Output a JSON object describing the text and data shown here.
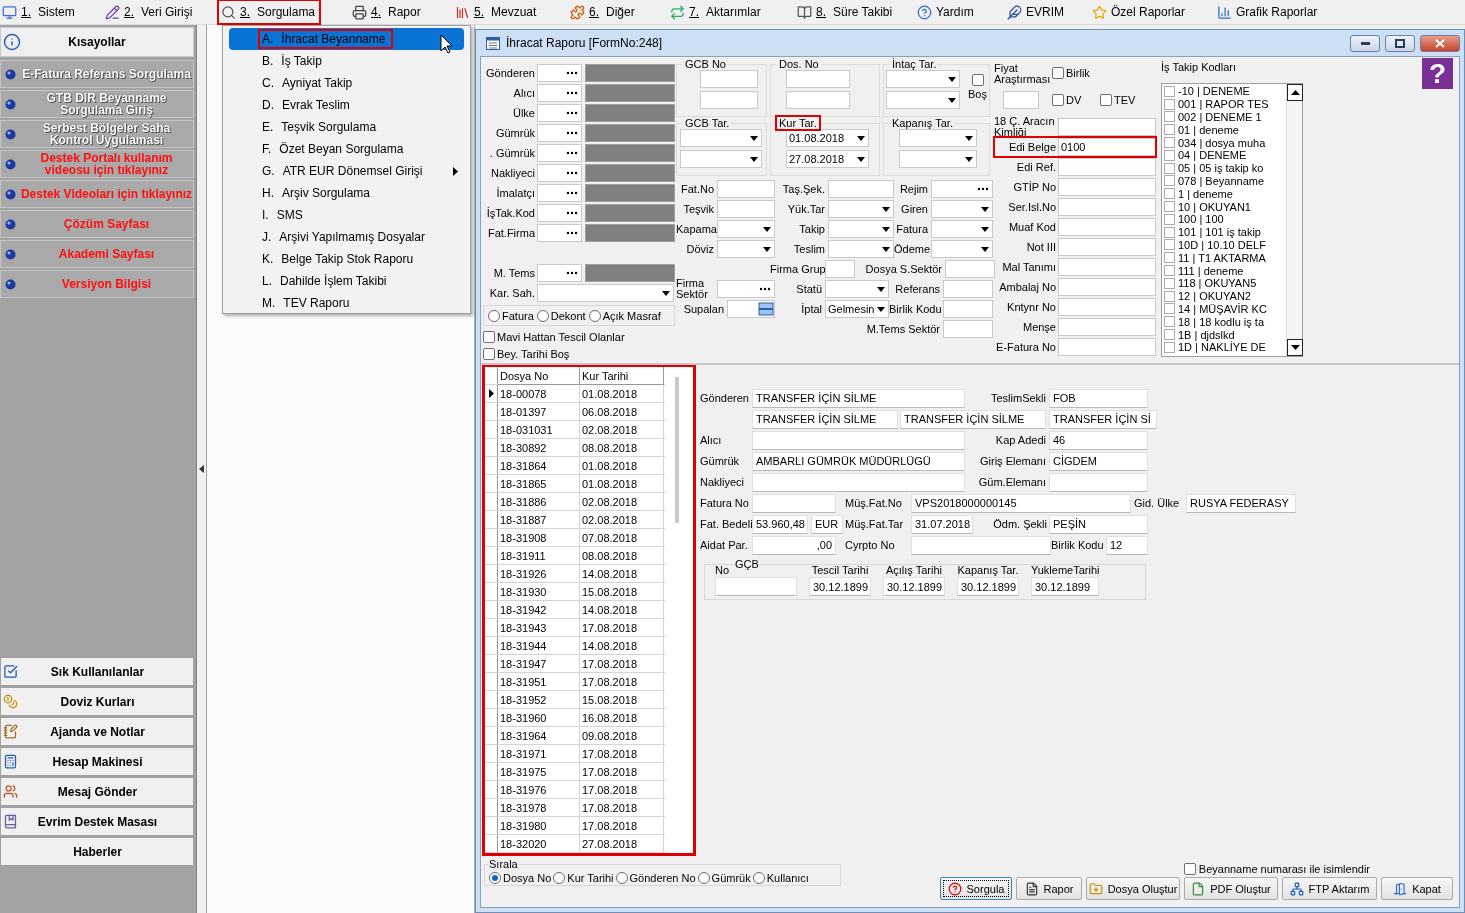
{
  "menu_bar": [
    {
      "key": "1.",
      "label": "Sistem",
      "marked": false
    },
    {
      "key": "2.",
      "label": "Veri Girişi",
      "marked": false
    },
    {
      "key": "3.",
      "label": "Sorgulama",
      "marked": true
    },
    {
      "key": "4.",
      "label": "Rapor",
      "marked": false
    },
    {
      "key": "5.",
      "label": "Mevzuat",
      "marked": false
    },
    {
      "key": "6.",
      "label": "Diğer",
      "marked": false
    },
    {
      "key": "7.",
      "label": "Aktarımlar",
      "marked": false
    },
    {
      "key": "8.",
      "label": "Süre Takibi",
      "marked": false
    },
    {
      "label": "Yardım",
      "marked": false
    },
    {
      "label": "EVRIM",
      "marked": false
    },
    {
      "label": "Özel Raporlar",
      "marked": false
    },
    {
      "label": "Grafik Raporlar",
      "marked": false
    }
  ],
  "sidebar": {
    "title": "Kısayollar",
    "links": [
      {
        "label": "E-Fatura Referans Sorgulama",
        "kind": "plain"
      },
      {
        "label": "GTB DIR Beyanname Sorgulama Giriş",
        "kind": "plain"
      },
      {
        "label": "Serbest Bölgeler Saha Kontrol Uygulaması",
        "kind": "plain"
      },
      {
        "label": "Destek Portalı kullanım videosu için tıklayınız",
        "kind": "alert"
      },
      {
        "label": "Destek Videoları için tıklayınız",
        "kind": "alert"
      },
      {
        "label": "Çözüm Sayfası",
        "kind": "alert"
      },
      {
        "label": "Akademi Sayfası",
        "kind": "alert"
      },
      {
        "label": "Versiyon Bilgisi",
        "kind": "alert"
      }
    ],
    "tools": [
      {
        "label": "Sık Kullanılanlar"
      },
      {
        "label": "Doviz Kurları"
      },
      {
        "label": "Ajanda ve Notlar"
      },
      {
        "label": "Hesap Makinesi"
      },
      {
        "label": "Mesaj Gönder"
      },
      {
        "label": "Evrim Destek Masası"
      },
      {
        "label": "Haberler"
      }
    ]
  },
  "dropdown": {
    "items": [
      {
        "key": "A.",
        "label": "İhracat Beyanname",
        "selected": true,
        "marked": true,
        "submenu": false
      },
      {
        "key": "B.",
        "label": "İş Takip",
        "selected": false,
        "marked": false,
        "submenu": false
      },
      {
        "key": "C.",
        "label": "Ayniyat Takip",
        "selected": false,
        "marked": false,
        "submenu": false
      },
      {
        "key": "D.",
        "label": "Evrak Teslim",
        "selected": false,
        "marked": false,
        "submenu": false
      },
      {
        "key": "E.",
        "label": "Teşvik Sorgulama",
        "selected": false,
        "marked": false,
        "submenu": false
      },
      {
        "key": "F.",
        "label": "Özet Beyan Sorgulama",
        "selected": false,
        "marked": false,
        "submenu": false
      },
      {
        "key": "G.",
        "label": "ATR EUR Dönemsel Girişi",
        "selected": false,
        "marked": false,
        "submenu": true
      },
      {
        "key": "H.",
        "label": "Arşiv Sorgulama",
        "selected": false,
        "marked": false,
        "submenu": false
      },
      {
        "key": "I.",
        "label": "SMS",
        "selected": false,
        "marked": false,
        "submenu": false
      },
      {
        "key": "J.",
        "label": "Arşivi Yapılmamış Dosyalar",
        "selected": false,
        "marked": false,
        "submenu": false
      },
      {
        "key": "K.",
        "label": "Belge Takip Stok Raporu",
        "selected": false,
        "marked": false,
        "submenu": false
      },
      {
        "key": "L.",
        "label": "Dahilde İşlem Takibi",
        "selected": false,
        "marked": false,
        "submenu": false
      },
      {
        "key": "M.",
        "label": "TEV Raporu",
        "selected": false,
        "marked": false,
        "submenu": false
      }
    ]
  },
  "window": {
    "title": "İhracat Raporu [FormNo:248]"
  },
  "parties": [
    {
      "label": "Gönderen"
    },
    {
      "label": "Alıcı"
    },
    {
      "label": "Ülke"
    },
    {
      "label": "Gümrük"
    },
    {
      "label": ". Gümrük"
    },
    {
      "label": "Nakliyeci"
    },
    {
      "label": "İmalatçı"
    },
    {
      "label": "İşTak.Kod"
    },
    {
      "label": "Fat.Firma"
    }
  ],
  "representative": {
    "label": "M. Tems"
  },
  "kar_sah": {
    "label": "Kar. Sah."
  },
  "document_type": [
    {
      "label": "Fatura",
      "selected": false
    },
    {
      "label": "Dekont",
      "selected": false
    },
    {
      "label": "Açık Masraf",
      "selected": false
    }
  ],
  "filter_checks": [
    {
      "label": "Mavi Hattan Tescil Olanlar",
      "checked": false
    },
    {
      "label": "Bey. Tarihi Boş",
      "checked": false
    }
  ],
  "groups": [
    {
      "title": "GCB No",
      "kind": "text",
      "marked": false
    },
    {
      "title": "Dos. No",
      "kind": "text",
      "marked": false
    },
    {
      "title": "İntaç Tar.",
      "kind": "combo",
      "marked": false,
      "check": {
        "label": "Boş",
        "checked": false
      }
    },
    {
      "title": "GCB Tar.",
      "kind": "combo",
      "marked": false
    },
    {
      "title": "Kur Tar.",
      "kind": "combo",
      "marked": true,
      "values": [
        "01.08.2018",
        "27.08.2018"
      ]
    },
    {
      "title": "Kapanış Tar.",
      "kind": "combo",
      "marked": false
    }
  ],
  "fields": [
    {
      "label": "Fat.No",
      "kind": "text"
    },
    {
      "label": "Taş.Şek.",
      "kind": "text"
    },
    {
      "label": "Rejim",
      "kind": "lookup"
    },
    {
      "label": "Teşvik",
      "kind": "text"
    },
    {
      "label": "Yük.Tar",
      "kind": "combo"
    },
    {
      "label": "Giren",
      "kind": "combo"
    },
    {
      "label": "Kapama",
      "kind": "combo"
    },
    {
      "label": "Takip",
      "kind": "combo"
    },
    {
      "label": "Fatura",
      "kind": "combo"
    },
    {
      "label": "Döviz",
      "kind": "combo"
    },
    {
      "label": "Teslim",
      "kind": "combo"
    },
    {
      "label": "Ödeme",
      "kind": "combo"
    },
    {
      "label": "Firma Grup",
      "kind": "text"
    },
    {
      "label": "Dosya S.Sektör",
      "kind": "text"
    },
    {
      "label": "Firma Sektör",
      "kind": "lookup"
    },
    {
      "label": "Statü",
      "kind": "combo"
    },
    {
      "label": "Referans",
      "kind": "text"
    },
    {
      "label": "Supalan",
      "kind": "picker"
    },
    {
      "label": "İptal",
      "kind": "combo",
      "value": "Gelmesin"
    },
    {
      "label": "Birlik Kodu",
      "kind": "text"
    },
    {
      "label": "M.Tems Sektör",
      "kind": "text"
    }
  ],
  "price_research": {
    "label": "Fiyat Araştırması",
    "checks": [
      {
        "label": "Birlik",
        "checked": false
      },
      {
        "label": "DV",
        "checked": false
      },
      {
        "label": "TEV",
        "checked": false
      }
    ]
  },
  "side_fields": [
    {
      "label": "18 Ç. Aracın Kimliği",
      "marked": false
    },
    {
      "label": "Edi Belge",
      "value": "0100",
      "marked": true
    },
    {
      "label": "Edi Ref.",
      "marked": false
    },
    {
      "label": "GTİP No",
      "marked": false
    },
    {
      "label": "Ser.Isl.No",
      "marked": false
    },
    {
      "label": "Muaf Kod",
      "marked": false
    },
    {
      "label": "Not III",
      "marked": false
    },
    {
      "label": "Mal Tanımı",
      "marked": false
    },
    {
      "label": "Ambalaj No",
      "marked": false
    },
    {
      "label": "Kntynr No",
      "marked": false
    },
    {
      "label": "Menşe",
      "marked": false
    },
    {
      "label": "E-Fatura No",
      "marked": false
    }
  ],
  "is_takip": {
    "title": "İş Takip Kodları",
    "items": [
      {
        "label": "-10 | DENEME",
        "checked": false
      },
      {
        "label": "001 | RAPOR TES",
        "checked": false
      },
      {
        "label": "002 | DENEME 1",
        "checked": false
      },
      {
        "label": "01 | deneme",
        "checked": false
      },
      {
        "label": "034 | dosya muha",
        "checked": false
      },
      {
        "label": "04 | DENEME",
        "checked": false
      },
      {
        "label": "05 | 05 iş takip ko",
        "checked": false
      },
      {
        "label": "078 | Beyanname",
        "checked": false
      },
      {
        "label": "1 | deneme",
        "checked": false
      },
      {
        "label": "10 | OKUYAN1",
        "checked": false
      },
      {
        "label": "100 | 100",
        "checked": false
      },
      {
        "label": "101 | 101 iş takip",
        "checked": false
      },
      {
        "label": "10D | 10.10 DELF",
        "checked": false
      },
      {
        "label": "11 | T1 AKTARMA",
        "checked": false
      },
      {
        "label": "111 | deneme",
        "checked": false
      },
      {
        "label": "118 | OKUYAN5",
        "checked": false
      },
      {
        "label": "12 | OKUYAN2",
        "checked": false
      },
      {
        "label": "14 | MÜŞAVİR KC",
        "checked": false
      },
      {
        "label": "18 | 18 kodlu iş ta",
        "checked": false
      },
      {
        "label": "1B | djdslkd",
        "checked": false
      },
      {
        "label": "1D | NAKLİYE DE",
        "checked": false
      }
    ]
  },
  "help_button": {
    "label": "?"
  },
  "grid": {
    "marked": true,
    "columns": [
      "Dosya No",
      "Kur Tarihi"
    ],
    "rows": [
      {
        "cells": [
          "18-00078",
          "01.08.2018"
        ],
        "selected": true
      },
      {
        "cells": [
          "18-01397",
          "06.08.2018"
        ],
        "selected": false
      },
      {
        "cells": [
          "18-031031",
          "02.08.2018"
        ],
        "selected": false
      },
      {
        "cells": [
          "18-30892",
          "08.08.2018"
        ],
        "selected": false
      },
      {
        "cells": [
          "18-31864",
          "01.08.2018"
        ],
        "selected": false
      },
      {
        "cells": [
          "18-31865",
          "01.08.2018"
        ],
        "selected": false
      },
      {
        "cells": [
          "18-31886",
          "02.08.2018"
        ],
        "selected": false
      },
      {
        "cells": [
          "18-31887",
          "02.08.2018"
        ],
        "selected": false
      },
      {
        "cells": [
          "18-31908",
          "07.08.2018"
        ],
        "selected": false
      },
      {
        "cells": [
          "18-31911",
          "08.08.2018"
        ],
        "selected": false
      },
      {
        "cells": [
          "18-31926",
          "14.08.2018"
        ],
        "selected": false
      },
      {
        "cells": [
          "18-31930",
          "15.08.2018"
        ],
        "selected": false
      },
      {
        "cells": [
          "18-31942",
          "14.08.2018"
        ],
        "selected": false
      },
      {
        "cells": [
          "18-31943",
          "17.08.2018"
        ],
        "selected": false
      },
      {
        "cells": [
          "18-31944",
          "14.08.2018"
        ],
        "selected": false
      },
      {
        "cells": [
          "18-31947",
          "17.08.2018"
        ],
        "selected": false
      },
      {
        "cells": [
          "18-31951",
          "17.08.2018"
        ],
        "selected": false
      },
      {
        "cells": [
          "18-31952",
          "15.08.2018"
        ],
        "selected": false
      },
      {
        "cells": [
          "18-31960",
          "16.08.2018"
        ],
        "selected": false
      },
      {
        "cells": [
          "18-31964",
          "09.08.2018"
        ],
        "selected": false
      },
      {
        "cells": [
          "18-31971",
          "17.08.2018"
        ],
        "selected": false
      },
      {
        "cells": [
          "18-31975",
          "17.08.2018"
        ],
        "selected": false
      },
      {
        "cells": [
          "18-31976",
          "17.08.2018"
        ],
        "selected": false
      },
      {
        "cells": [
          "18-31978",
          "17.08.2018"
        ],
        "selected": false
      },
      {
        "cells": [
          "18-31980",
          "17.08.2018"
        ],
        "selected": false
      },
      {
        "cells": [
          "18-32020",
          "27.08.2018"
        ],
        "selected": false
      }
    ]
  },
  "detail": {
    "fields": [
      {
        "label": "Gönderen",
        "boxes": [
          {
            "kind": "text",
            "text": "TRANSFER İÇİN SİLME"
          }
        ]
      },
      {
        "label": "TeslimSekli",
        "boxes": [
          {
            "kind": "text",
            "text": "FOB"
          }
        ]
      },
      {
        "boxes": [
          {
            "kind": "text",
            "text": "TRANSFER İÇİN SİLME"
          },
          {
            "kind": "text",
            "text": "TRANSFER İÇİN SİLME"
          }
        ]
      },
      {
        "boxes": [
          {
            "kind": "text",
            "text": "TRANSFER İÇİN Sİ"
          }
        ]
      },
      {
        "label": "Alıcı",
        "boxes": [
          {
            "kind": "empty"
          }
        ]
      },
      {
        "label": "Kap Adedi",
        "boxes": [
          {
            "kind": "text",
            "text": "46"
          }
        ]
      },
      {
        "label": "Gümrük",
        "boxes": [
          {
            "kind": "text",
            "text": "AMBARLI  GÜMRÜK MÜDÜRLÜGÜ"
          }
        ]
      },
      {
        "label": "Giriş Elemanı",
        "boxes": [
          {
            "kind": "text",
            "text": "CİGDEM"
          }
        ]
      },
      {
        "label": "Nakliyeci",
        "boxes": [
          {
            "kind": "empty"
          }
        ]
      },
      {
        "label": "Güm.Elemanı",
        "boxes": [
          {
            "kind": "empty"
          }
        ]
      },
      {
        "label": "Fatura No",
        "boxes": [
          {
            "kind": "empty"
          }
        ]
      },
      {
        "label": "Müş.Fat.No",
        "boxes": [
          {
            "kind": "text",
            "text": "VPS2018000000145"
          }
        ]
      },
      {
        "label": "Gid. Ülke",
        "boxes": [
          {
            "kind": "text",
            "text": "RUSYA FEDERASY"
          }
        ]
      },
      {
        "label": "Fat. Bedeli",
        "boxes": [
          {
            "kind": "text",
            "text": "53.960,48"
          },
          {
            "kind": "text",
            "text": "EUR"
          }
        ]
      },
      {
        "label": "Müş.Fat.Tar",
        "boxes": [
          {
            "kind": "text",
            "text": "31.07.2018"
          }
        ]
      },
      {
        "label": "Ödm. Şekli",
        "boxes": [
          {
            "kind": "text",
            "text": "PEŞİN"
          }
        ]
      },
      {
        "label": "Aidat Par.",
        "boxes": [
          {
            "kind": "number",
            "text": ",00"
          }
        ]
      },
      {
        "label": "Cyrpto No",
        "boxes": [
          {
            "kind": "empty"
          }
        ]
      },
      {
        "label": "Birlik Kodu",
        "boxes": [
          {
            "kind": "text",
            "text": "12"
          }
        ]
      }
    ],
    "gcb": {
      "title": "GÇB",
      "columns": [
        {
          "label": "No"
        },
        {
          "label": "Tescil Tarihi",
          "value": "30.12.1899"
        },
        {
          "label": "Açılış Tarihi",
          "value": "30.12.1899"
        },
        {
          "label": "Kapanış Tar.",
          "value": "30.12.1899"
        },
        {
          "label": "YuklemeTarihi",
          "value": "30.12.1899"
        }
      ]
    }
  },
  "sort": {
    "title": "Sırala",
    "options": [
      {
        "label": "Dosya No",
        "selected": true
      },
      {
        "label": "Kur Tarihi",
        "selected": false
      },
      {
        "label": "Gönderen No",
        "selected": false
      },
      {
        "label": "Gümrük",
        "selected": false
      },
      {
        "label": "Kullanıcı",
        "selected": false
      }
    ]
  },
  "name_check": {
    "label": "Beyanname numarası ile isimlendir",
    "checked": false
  },
  "buttons": [
    {
      "label": "Sorgula",
      "focused": true
    },
    {
      "label": "Rapor",
      "focused": false
    },
    {
      "label": "Dosya Oluştur",
      "focused": false
    },
    {
      "label": "PDF Oluştur",
      "focused": false
    },
    {
      "label": "FTP Aktarım",
      "focused": false
    },
    {
      "label": "Kapat",
      "focused": false
    }
  ]
}
